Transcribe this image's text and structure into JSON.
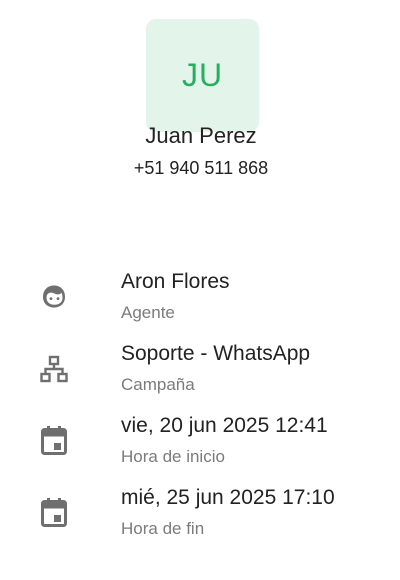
{
  "contact": {
    "initials": "JU",
    "name": "Juan Perez",
    "phone": "+51 940 511 868",
    "avatar_bg": "#e3f4ea",
    "avatar_text_color": "#27ae60"
  },
  "details": [
    {
      "icon": "agent-icon",
      "value": "Aron Flores",
      "label": "Agente"
    },
    {
      "icon": "sitemap-icon",
      "value": "Soporte - WhatsApp",
      "label": "Campaña"
    },
    {
      "icon": "calendar-icon",
      "value": "vie, 20 jun 2025 12:41",
      "label": "Hora de inicio"
    },
    {
      "icon": "calendar-icon",
      "value": "mié, 25 jun 2025 17:10",
      "label": "Hora de fin"
    }
  ]
}
